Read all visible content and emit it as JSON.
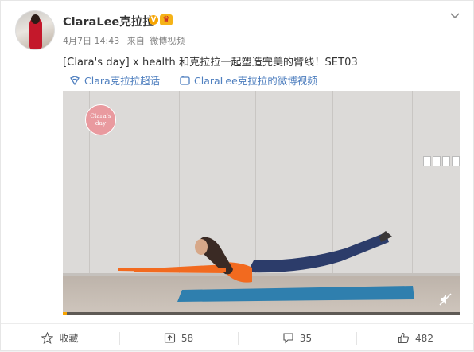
{
  "post": {
    "username": "ClaraLee克拉拉",
    "vip_badge": "V",
    "date": "4月7日 14:43",
    "source_prefix": "来自",
    "source": "微博视频",
    "text": "[Clara's day] x health 和克拉拉一起塑造完美的臂线！SET03",
    "links": [
      {
        "label": "Clara克拉拉超话",
        "icon": "super-topic-icon"
      },
      {
        "label": "ClaraLee克拉拉的微博视频",
        "icon": "video-icon"
      }
    ]
  },
  "video": {
    "logo_text_1": "Clara's",
    "logo_text_2": "day",
    "progress": 0.002
  },
  "actions": {
    "favorite_label": "收藏",
    "repost_count": "58",
    "comment_count": "35",
    "like_count": "482"
  },
  "colors": {
    "accent": "#f7a400",
    "link": "#4f7fbf",
    "shirt": "#f26a1f",
    "pants": "#2c3c6a",
    "mat": "#2f7fae"
  }
}
